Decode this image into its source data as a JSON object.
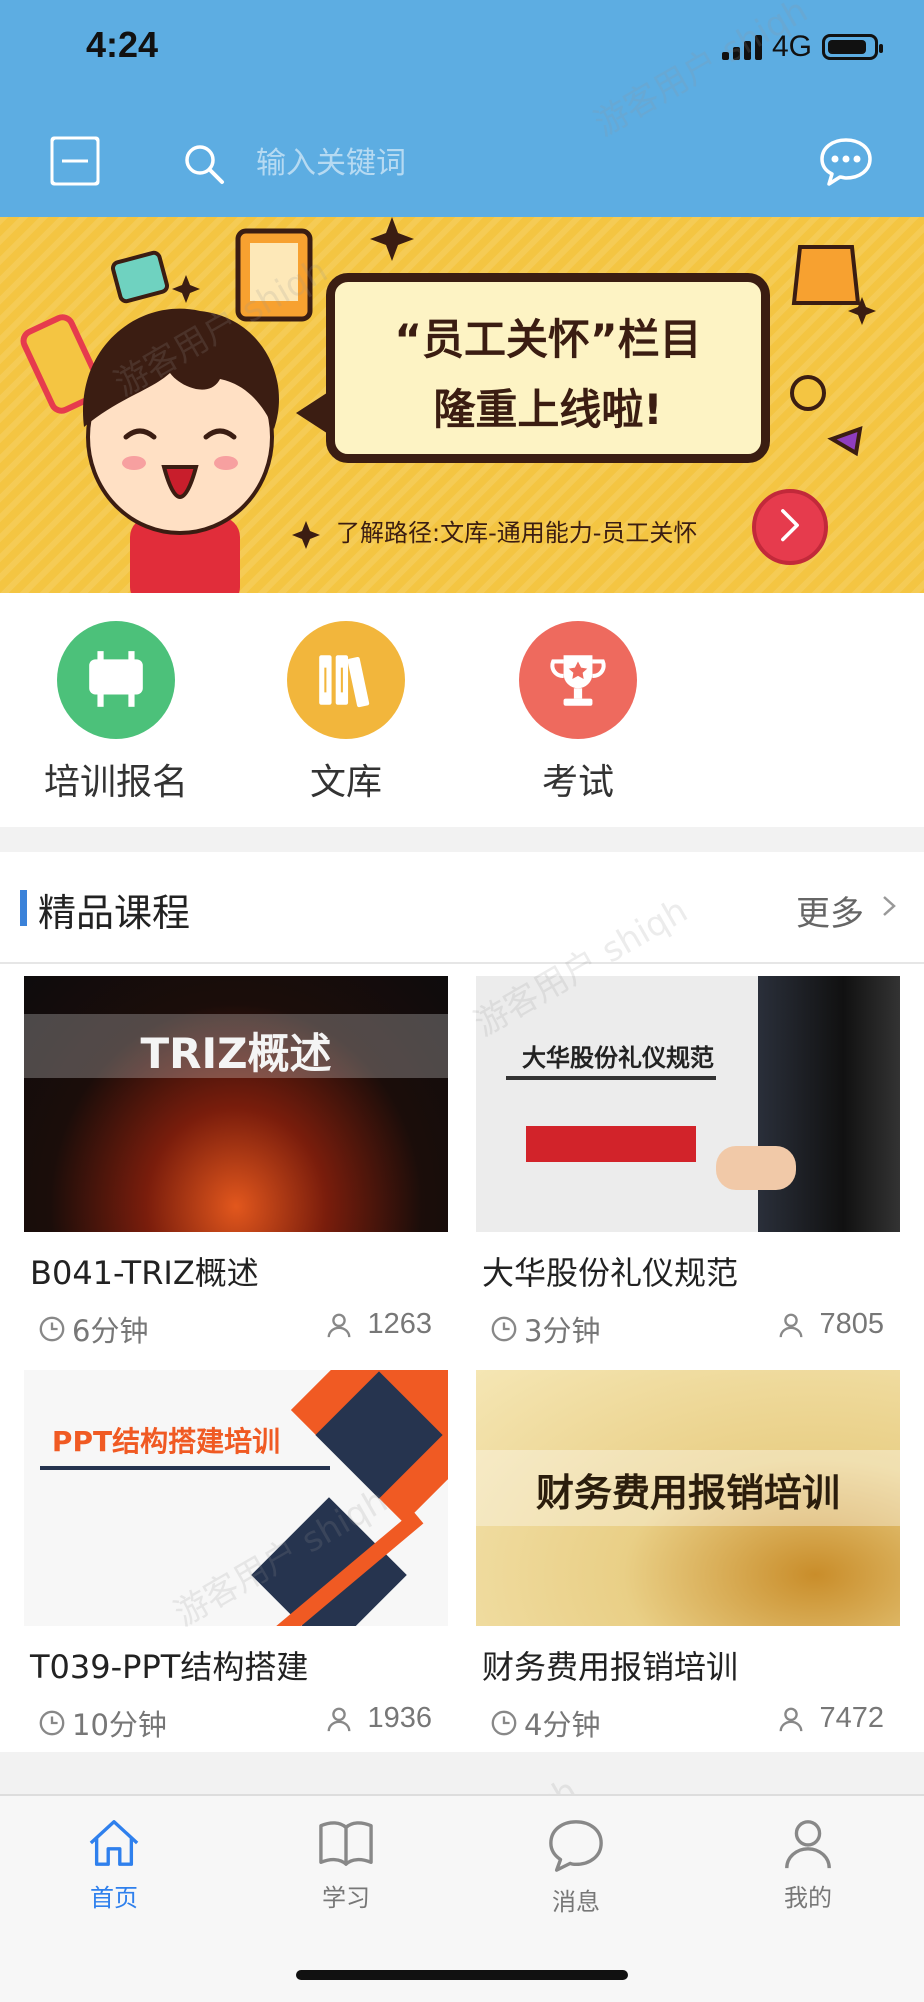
{
  "status": {
    "time": "4:24",
    "network": "4G"
  },
  "search": {
    "placeholder": "输入关键词"
  },
  "banner": {
    "headline_line1": "“员工关怀”栏目",
    "headline_line2": "隆重上线啦!",
    "path_text": "了解路径:文库-通用能力-员工关怀"
  },
  "nav": {
    "items": [
      {
        "label": "培训报名",
        "color": "#4cc17a",
        "icon": "signboard-icon"
      },
      {
        "label": "文库",
        "color": "#f2b63c",
        "icon": "books-icon"
      },
      {
        "label": "考试",
        "color": "#ee6a5e",
        "icon": "trophy-icon"
      }
    ]
  },
  "section": {
    "title": "精品课程",
    "more": "更多"
  },
  "courses": [
    {
      "title": "B041-TRIZ概述",
      "thumb_text": "TRIZ概述",
      "duration": "6分钟",
      "views": "1263"
    },
    {
      "title": "大华股份礼仪规范",
      "thumb_text": "大华股份礼仪规范",
      "duration": "3分钟",
      "views": "7805"
    },
    {
      "title": "T039-PPT结构搭建",
      "thumb_text": "PPT结构搭建培训",
      "duration": "10分钟",
      "views": "1936"
    },
    {
      "title": "财务费用报销培训",
      "thumb_text": "财务费用报销培训",
      "duration": "4分钟",
      "views": "7472"
    }
  ],
  "watermark": "游客用户 shiqh",
  "tabs": [
    {
      "label": "首页",
      "active": true
    },
    {
      "label": "学习",
      "active": false
    },
    {
      "label": "消息",
      "active": false
    },
    {
      "label": "我的",
      "active": false
    }
  ],
  "colors": {
    "header": "#5dade2",
    "accent": "#3b82d9",
    "banner": "#f4c542"
  }
}
